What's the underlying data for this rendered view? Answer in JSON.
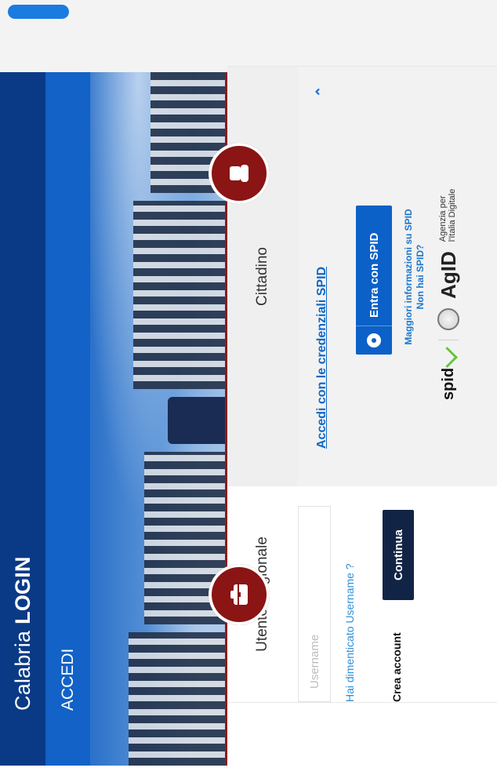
{
  "app": {
    "brand_regular": "Calabria",
    "brand_bold": "LOGIN",
    "subtitle": "ACCEDI"
  },
  "login": {
    "left": {
      "title": "Utente Regionale",
      "username_placeholder": "Username",
      "forgot_text": "Hai dimenticato Username ?",
      "continue_label": "Continua",
      "create_account": "Crea account"
    },
    "right": {
      "title": "Cittadino",
      "spid_link": "Accedi con le credenziali SPID",
      "spid_button": "Entra con SPID",
      "info_1": "Maggiori informazioni su SPID",
      "info_2": "Non hai SPID?",
      "logo_spid": "spid",
      "logo_agid": "AgID",
      "agid_desc_1": "Agenzia per",
      "agid_desc_2": "l'Italia Digitale"
    }
  },
  "icons": {
    "left_badge": "briefcase-icon",
    "right_badge": "user-icon",
    "chevron": "chevron-up-icon"
  },
  "colors": {
    "appbar": "#0a3a86",
    "subbar": "#1262c7",
    "badge": "#8b1414",
    "continue": "#122446",
    "spid": "#0b61c7"
  }
}
